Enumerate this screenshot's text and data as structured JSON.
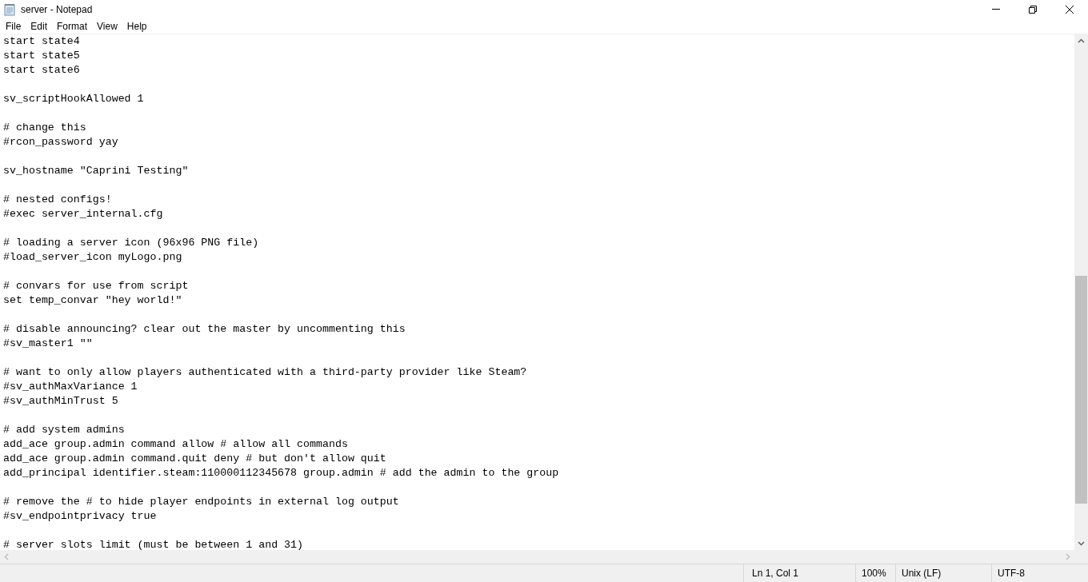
{
  "window": {
    "title": "server - Notepad"
  },
  "menu": [
    "File",
    "Edit",
    "Format",
    "View",
    "Help"
  ],
  "editor": {
    "blocks": [
      [
        "start state4",
        "start state5",
        "start state6"
      ],
      [
        "sv_scriptHookAllowed 1"
      ],
      [
        "# change this",
        "#rcon_password yay"
      ],
      [
        "sv_hostname \"Caprini Testing\""
      ],
      [
        "# nested configs!",
        "#exec server_internal.cfg"
      ],
      [
        "# loading a server icon (96x96 PNG file)",
        "#load_server_icon myLogo.png"
      ],
      [
        "# convars for use from script",
        "set temp_convar \"hey world!\""
      ],
      [
        "# disable announcing? clear out the master by uncommenting this",
        "#sv_master1 \"\""
      ],
      [
        "# want to only allow players authenticated with a third-party provider like Steam?",
        "#sv_authMaxVariance 1",
        "#sv_authMinTrust 5"
      ],
      [
        "# add system admins",
        "add_ace group.admin command allow # allow all commands",
        "add_ace group.admin command.quit deny # but don't allow quit",
        "add_principal identifier.steam:110000112345678 group.admin # add the admin to the group"
      ],
      [
        "# remove the # to hide player endpoints in external log output",
        "#sv_endpointprivacy true"
      ],
      [
        "# server slots limit (must be between 1 and 31)"
      ]
    ]
  },
  "status_bar": {
    "position": "Ln 1, Col 1",
    "zoom": "100%",
    "line_ending": "Unix (LF)",
    "encoding": "UTF-8"
  }
}
